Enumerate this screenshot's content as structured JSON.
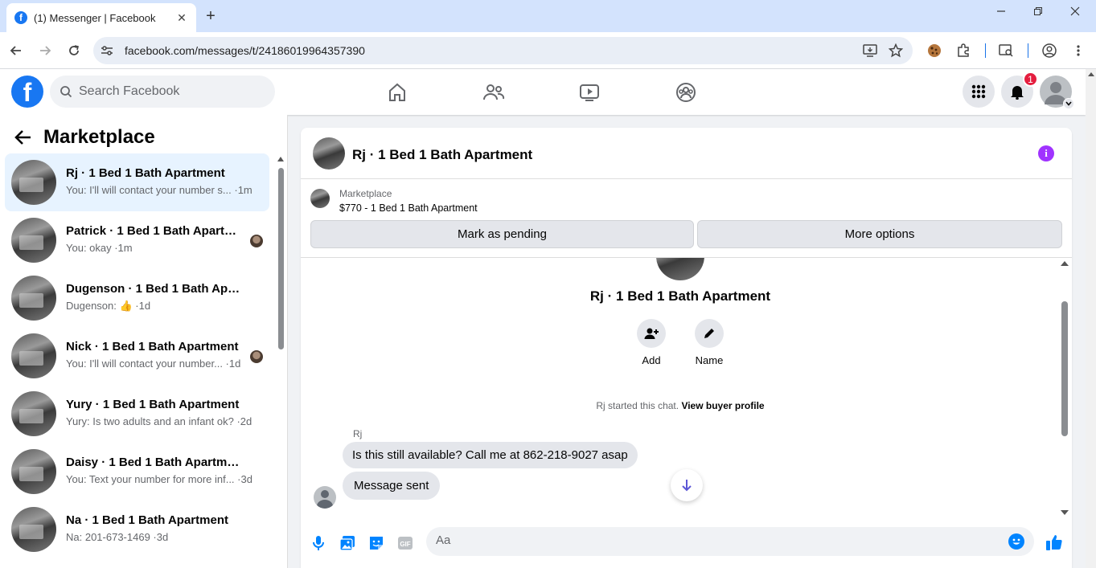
{
  "browser": {
    "tab_title": "(1) Messenger | Facebook",
    "tab_favicon": "f",
    "close_glyph": "✕",
    "newtab_glyph": "+",
    "url": "facebook.com/messages/t/24186019964357390"
  },
  "fb_header": {
    "logo": "f",
    "search_placeholder": "Search Facebook",
    "notifications_count": "1"
  },
  "sidebar": {
    "title": "Marketplace",
    "conversations": [
      {
        "name": "Rj · 1 Bed 1 Bath Apartment",
        "preview": "You: I'll will contact your number s... ·1m",
        "active": true
      },
      {
        "name": "Patrick · 1 Bed 1 Bath Apartme...",
        "preview": "You: okay ·1m"
      },
      {
        "name": "Dugenson · 1 Bed 1 Bath Apartm...",
        "preview": "Dugenson: 👍 ·1d"
      },
      {
        "name": "Nick · 1 Bed 1 Bath Apartment",
        "preview": "You: I'll will contact your number... ·1d"
      },
      {
        "name": "Yury · 1 Bed 1 Bath Apartment",
        "preview": "Yury: Is two adults and an infant ok? ·2d"
      },
      {
        "name": "Daisy · 1 Bed 1 Bath Apartment",
        "preview": "You: Text your number for more inf... ·3d"
      },
      {
        "name": "Na · 1 Bed 1 Bath Apartment",
        "preview": "Na: 201-673-1469 ·3d"
      }
    ]
  },
  "chat": {
    "title": "Rj · 1 Bed 1 Bath Apartment",
    "info_glyph": "i",
    "marketplace_label": "Marketplace",
    "listing": "$770 - 1 Bed 1 Bath Apartment",
    "mark_pending_label": "Mark as pending",
    "more_options_label": "More options",
    "profile_name": "Rj · 1 Bed 1 Bath Apartment",
    "add_label": "Add",
    "name_label": "Name",
    "started_text": "Rj started this chat. ",
    "view_profile_link": "View buyer profile",
    "sender": "Rj",
    "messages": [
      {
        "text": "Is this still available? Call me at 862-218-9027 asap"
      },
      {
        "text": "Message sent"
      }
    ],
    "composer_placeholder": "Aa",
    "accent_color": "#0084ff",
    "info_color": "#a033ff"
  }
}
